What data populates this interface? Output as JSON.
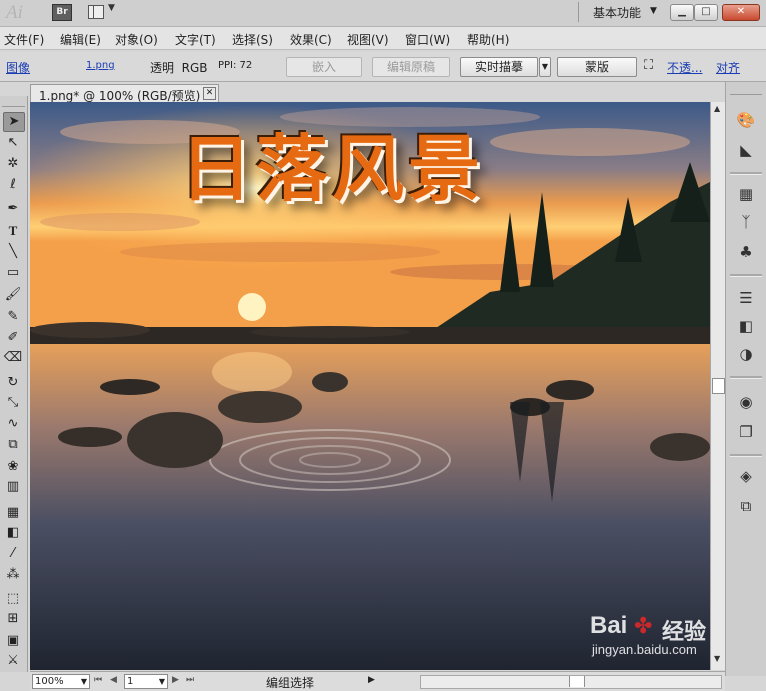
{
  "app": {
    "logo": "Ai",
    "bridge_label": "Br",
    "workspace": "基本功能",
    "window_controls": {
      "minimize": "▁",
      "maximize": "□",
      "close": "✕"
    }
  },
  "menu": [
    "文件(F)",
    "编辑(E)",
    "对象(O)",
    "文字(T)",
    "选择(S)",
    "效果(C)",
    "视图(V)",
    "窗口(W)",
    "帮助(H)"
  ],
  "control_bar": {
    "image_link": "图像",
    "file_link": "1.png",
    "color_info": "透明  RGB",
    "ppi": "PPI: 72",
    "embed_button": "嵌入",
    "edit_original_button": "编辑原稿",
    "live_trace_button": "实时描摹",
    "mask_button": "蒙版",
    "opacity_link": "不透...",
    "align_link": "对齐"
  },
  "document": {
    "tab_title": "1.png* @ 100% (RGB/预览)",
    "tab_close": "✕",
    "artwork_title": "日落风景"
  },
  "status_bar": {
    "zoom": "100%",
    "artboard": "1",
    "status_text": "编组选择"
  },
  "watermark": {
    "brand": "Bai",
    "brand_suffix": "du",
    "site_name": "经验",
    "url": "jingyan.baidu.com"
  },
  "colors": {
    "sky_top": "#3d5a88",
    "sunset_orange": "#f29a3c",
    "text_orange": "#e56a12",
    "water_dark": "#1f2430"
  },
  "tools": [
    "selection-tool",
    "direct-selection-tool",
    "magic-wand-tool",
    "lasso-tool",
    "pen-tool",
    "type-tool",
    "line-tool",
    "rectangle-tool",
    "paintbrush-tool",
    "pencil-tool",
    "blob-brush-tool",
    "eraser-tool",
    "rotate-tool",
    "scale-tool",
    "warp-tool",
    "free-transform-tool",
    "symbol-sprayer-tool",
    "graph-tool",
    "mesh-tool",
    "gradient-tool",
    "eyedropper-tool",
    "blend-tool",
    "live-paint-tool",
    "live-paint-selection-tool",
    "artboard-tool",
    "slice-tool",
    "hand-tool",
    "zoom-tool"
  ]
}
